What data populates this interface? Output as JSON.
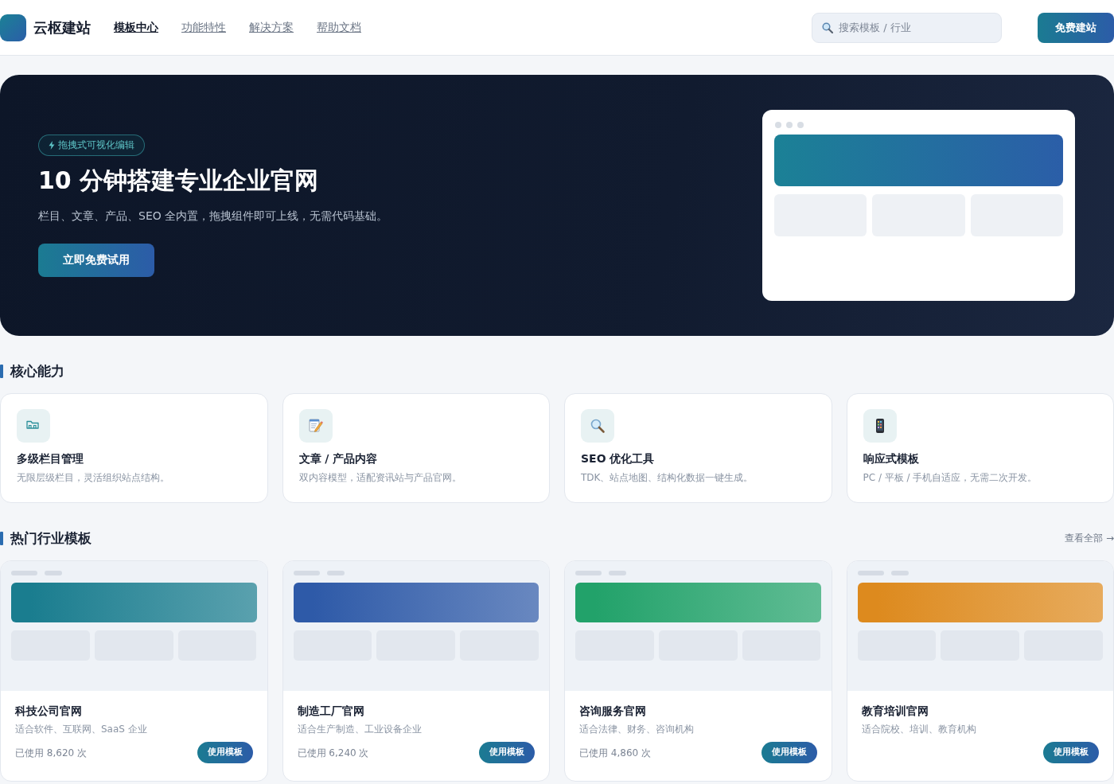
{
  "header": {
    "brand": "云枢建站",
    "nav": [
      {
        "label": "模板中心",
        "selected": true
      },
      {
        "label": "功能特性",
        "selected": false
      },
      {
        "label": "解决方案",
        "selected": false
      },
      {
        "label": "帮助文档",
        "selected": false
      }
    ],
    "search": {
      "placeholder": "搜索模板 / 行业"
    },
    "cta": "免费建站"
  },
  "hero": {
    "badge": "拖拽式可视化编辑",
    "title": "10 分钟搭建专业企业官网",
    "subtitle": "栏目、文章、产品、SEO 全内置，拖拽组件即可上线，无需代码基础。",
    "button": "立即免费试用"
  },
  "features": {
    "title": "核心能力",
    "items": [
      {
        "title": "多级栏目管理",
        "description": "无限层级栏目，灵活组织站点结构。"
      },
      {
        "title": "文章 / 产品内容",
        "description": "双内容模型，适配资讯站与产品官网。"
      },
      {
        "title": "SEO 优化工具",
        "description": "TDK、站点地图、结构化数据一键生成。"
      },
      {
        "title": "响应式模板",
        "description": "PC / 平板 / 手机自适应，无需二次开发。"
      }
    ]
  },
  "templates": {
    "title": "热门行业模板",
    "view_all": "查看全部 →",
    "items": [
      {
        "title": "科技公司官网",
        "description": "适合软件、互联网、SaaS 企业",
        "usage": "已使用 8,620 次",
        "button": "使用模板",
        "color": "#1a7d8f"
      },
      {
        "title": "制造工厂官网",
        "description": "适合生产制造、工业设备企业",
        "usage": "已使用 6,240 次",
        "button": "使用模板",
        "color": "#2e5aa8"
      },
      {
        "title": "咨询服务官网",
        "description": "适合法律、财务、咨询机构",
        "usage": "已使用 4,860 次",
        "button": "使用模板",
        "color": "#22a26a"
      },
      {
        "title": "教育培训官网",
        "description": "适合院校、培训、教育机构",
        "button": "使用模板",
        "color": "#dd8a1e"
      }
    ]
  }
}
